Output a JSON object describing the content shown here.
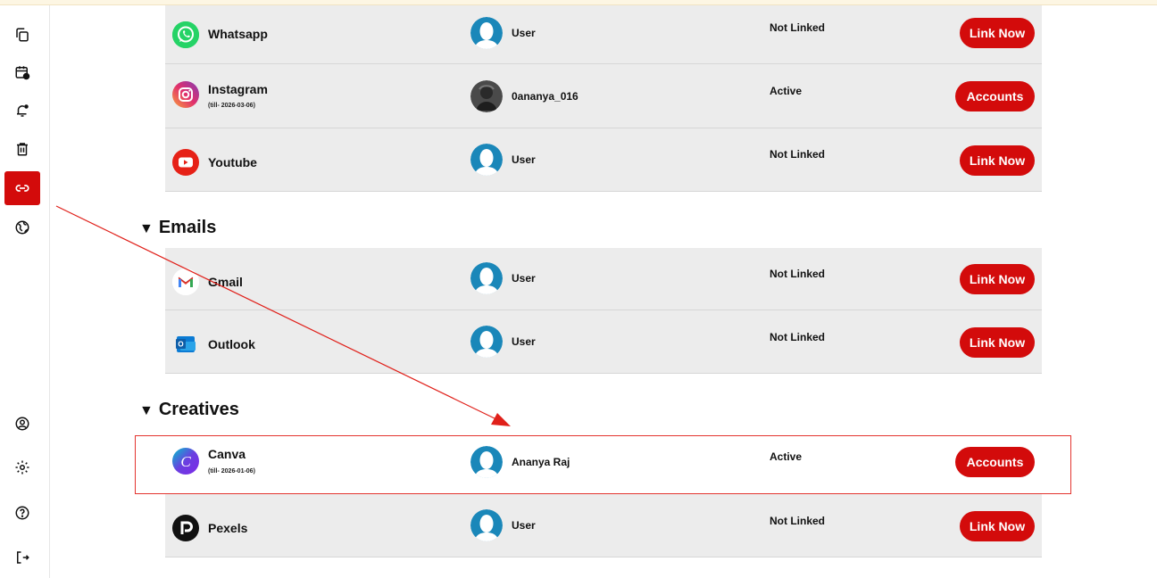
{
  "sidebar": {
    "top_items": [
      {
        "icon": "copy-icon"
      },
      {
        "icon": "calendar-clock-icon"
      },
      {
        "icon": "bell-icon"
      },
      {
        "icon": "trash-icon"
      },
      {
        "icon": "link-icon",
        "active": true
      },
      {
        "icon": "globe-icon"
      }
    ],
    "bottom_items": [
      {
        "icon": "user-circle-icon"
      },
      {
        "icon": "gear-icon"
      },
      {
        "icon": "help-icon"
      },
      {
        "icon": "logout-icon"
      }
    ]
  },
  "accent_color": "#d30b0b",
  "sections": {
    "emails": {
      "title": "Emails"
    },
    "creatives": {
      "title": "Creatives"
    }
  },
  "rows": {
    "whatsapp": {
      "name": "Whatsapp",
      "user": "User",
      "status": "Not Linked",
      "action": "Link Now",
      "icon": "whatsapp-icon"
    },
    "instagram": {
      "name": "Instagram",
      "sub": "(till- 2026-03-06)",
      "user": "0ananya_016",
      "status": "Active",
      "action": "Accounts",
      "icon": "instagram-icon"
    },
    "youtube": {
      "name": "Youtube",
      "user": "User",
      "status": "Not Linked",
      "action": "Link Now",
      "icon": "youtube-icon"
    },
    "gmail": {
      "name": "Gmail",
      "user": "User",
      "status": "Not Linked",
      "action": "Link Now",
      "icon": "gmail-icon"
    },
    "outlook": {
      "name": "Outlook",
      "user": "User",
      "status": "Not Linked",
      "action": "Link Now",
      "icon": "outlook-icon"
    },
    "canva": {
      "name": "Canva",
      "sub": "(till- 2026-01-06)",
      "user": "Ananya Raj",
      "status": "Active",
      "action": "Accounts",
      "icon": "canva-icon"
    },
    "pexels": {
      "name": "Pexels",
      "user": "User",
      "status": "Not Linked",
      "action": "Link Now",
      "icon": "pexels-icon"
    }
  }
}
